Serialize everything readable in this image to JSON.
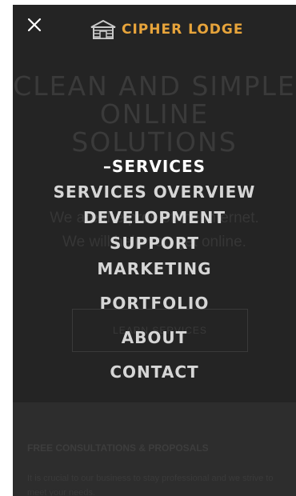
{
  "background": {
    "headline": "CLEAN AND SIMPLE ONLINE SOLUTIONS",
    "body": "We are the pros of the internet. We will help you get online.",
    "button_label": "LEARN SERVICES",
    "section_title": "FREE CONSULTATIONS & PROPOSALS",
    "section_text": "It is crucial to our business to stay professional and we strive to meet your needs."
  },
  "header": {
    "logo_text": "CIPHER LODGE",
    "close_icon": "close-icon",
    "logo_icon": "cabin-icon"
  },
  "menu": {
    "active_marker": "–",
    "items": [
      {
        "label": "SERVICES"
      },
      {
        "label": "SERVICES OVERVIEW"
      },
      {
        "label": "DEVELOPMENT"
      },
      {
        "label": "SUPPORT"
      },
      {
        "label": "MARKETING"
      },
      {
        "label": "PORTFOLIO"
      },
      {
        "label": "ABOUT"
      },
      {
        "label": "CONTACT"
      }
    ]
  },
  "colors": {
    "overlay_bg": "#2a2a2a",
    "logo_accent": "#e7a43b",
    "menu_text": "#d6d6d6",
    "active_text": "#ffffff"
  }
}
